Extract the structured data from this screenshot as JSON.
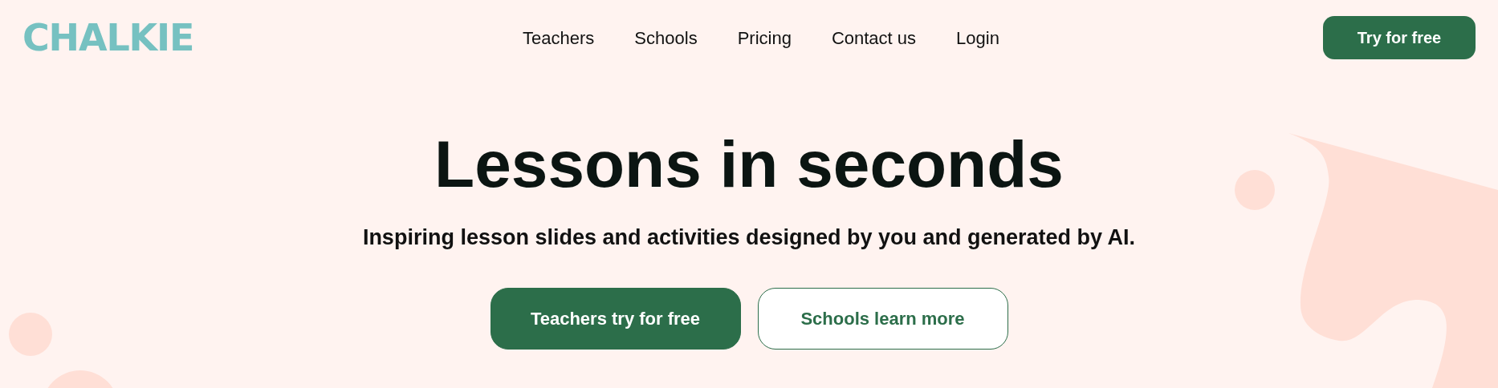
{
  "header": {
    "logo": "CHALKIE",
    "nav": [
      {
        "label": "Teachers"
      },
      {
        "label": "Schools"
      },
      {
        "label": "Pricing"
      },
      {
        "label": "Contact us"
      },
      {
        "label": "Login"
      }
    ],
    "cta": "Try for free"
  },
  "hero": {
    "title": "Lessons in seconds",
    "subtitle": "Inspiring lesson slides and activities designed by you and generated by AI.",
    "buttons": [
      {
        "label": "Teachers try for free",
        "kind": "primary"
      },
      {
        "label": "Schools learn more",
        "kind": "outline"
      }
    ]
  }
}
